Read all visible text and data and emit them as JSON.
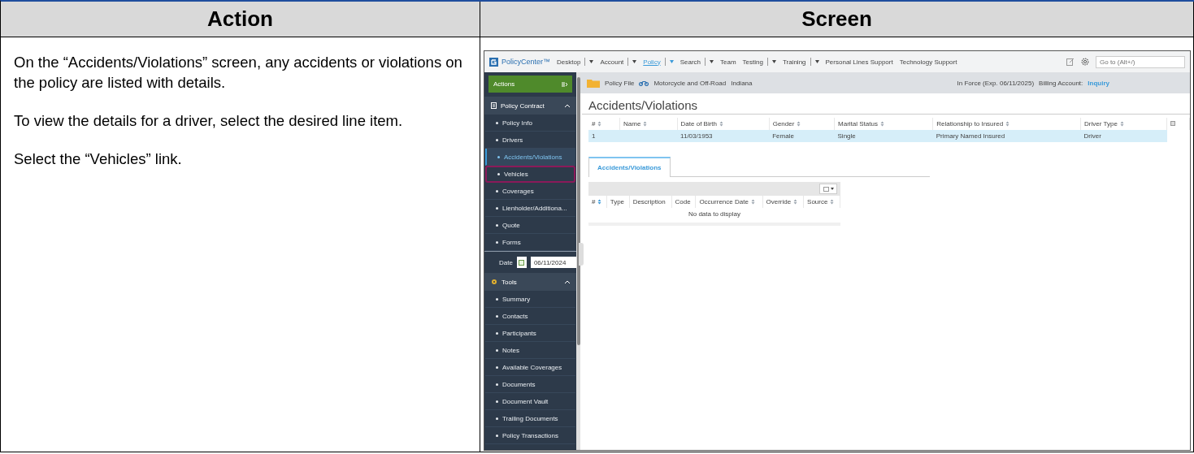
{
  "columns": [
    {
      "label": "Action"
    },
    {
      "label": "Screen"
    }
  ],
  "action_paragraphs": [
    "On the “Accidents/Violations” screen, any accidents or violations on the policy are listed with details.",
    "To view the details for a driver, select the desired line item.",
    "Select the “Vehicles” link."
  ],
  "app": {
    "logo": "PolicyCenter™",
    "nav": [
      {
        "label": "Desktop",
        "dropdown": true,
        "selected": false
      },
      {
        "label": "Account",
        "dropdown": true,
        "selected": false
      },
      {
        "label": "Policy",
        "dropdown": true,
        "selected": true
      },
      {
        "label": "Search",
        "dropdown": true,
        "selected": false
      },
      {
        "label": "Team",
        "dropdown": false,
        "selected": false
      },
      {
        "label": "Testing",
        "dropdown": true,
        "selected": false
      },
      {
        "label": "Training",
        "dropdown": true,
        "selected": false
      },
      {
        "label": "Personal Lines Support",
        "dropdown": false,
        "selected": false
      },
      {
        "label": "Technology Support",
        "dropdown": false,
        "selected": false
      }
    ],
    "search": {
      "placeholder": "Go to (Alt+/)"
    },
    "actions_button": "Actions",
    "policy_contract": {
      "label": "Policy Contract",
      "expanded": true,
      "items": [
        {
          "label": "Policy Info",
          "selected": false,
          "outlined": false
        },
        {
          "label": "Drivers",
          "selected": false,
          "outlined": false
        },
        {
          "label": "Accidents/Violations",
          "selected": true,
          "outlined": false
        },
        {
          "label": "Vehicles",
          "selected": false,
          "outlined": true
        },
        {
          "label": "Coverages",
          "selected": false,
          "outlined": false
        },
        {
          "label": "Lienholder/Additiona...",
          "selected": false,
          "outlined": false
        },
        {
          "label": "Quote",
          "selected": false,
          "outlined": false
        },
        {
          "label": "Forms",
          "selected": false,
          "outlined": false
        }
      ]
    },
    "date": {
      "label": "Date",
      "value": "06/11/2024"
    },
    "tools": {
      "label": "Tools",
      "expanded": true,
      "items": [
        {
          "label": "Summary",
          "selected": false,
          "outlined": false
        },
        {
          "label": "Contacts",
          "selected": false,
          "outlined": false
        },
        {
          "label": "Participants",
          "selected": false,
          "outlined": false
        },
        {
          "label": "Notes",
          "selected": false,
          "outlined": false
        },
        {
          "label": "Available Coverages",
          "selected": false,
          "outlined": false
        },
        {
          "label": "Documents",
          "selected": false,
          "outlined": false
        },
        {
          "label": "Document Vault",
          "selected": false,
          "outlined": false
        },
        {
          "label": "Trailing Documents",
          "selected": false,
          "outlined": false
        },
        {
          "label": "Policy Transactions",
          "selected": false,
          "outlined": false
        }
      ]
    },
    "info_bar": {
      "policy_file": "Policy File",
      "product": "Motorcycle and Off-Road",
      "state": "Indiana",
      "status": "In Force (Exp. 06/11/2025)",
      "billing_label": "Billing Account:",
      "billing_link": "Inquiry"
    },
    "page_title": "Accidents/Violations",
    "drivers_table": {
      "columns": [
        {
          "label": "#",
          "sortable": true
        },
        {
          "label": "Name",
          "sortable": true
        },
        {
          "label": "Date of Birth",
          "sortable": true
        },
        {
          "label": "Gender",
          "sortable": true
        },
        {
          "label": "Marital Status",
          "sortable": true
        },
        {
          "label": "Relationship to Insured",
          "sortable": true
        },
        {
          "label": "Driver Type",
          "sortable": true
        }
      ],
      "rows": [
        {
          "selected": true,
          "cells": [
            "1",
            null,
            "11/03/1953",
            "Female",
            "Single",
            "Primary Named Insured",
            "Driver"
          ]
        }
      ]
    },
    "tabs": [
      {
        "label": "Accidents/Violations",
        "selected": true
      }
    ],
    "incidents_table": {
      "columns": [
        {
          "label": "#",
          "sortable": true
        },
        {
          "label": "Type",
          "sortable": false
        },
        {
          "label": "Description",
          "sortable": false
        },
        {
          "label": "Code",
          "sortable": false
        },
        {
          "label": "Occurrence Date",
          "sortable": true
        },
        {
          "label": "Override",
          "sortable": true
        },
        {
          "label": "Source",
          "sortable": true
        }
      ],
      "empty_message": "No data to display"
    }
  }
}
